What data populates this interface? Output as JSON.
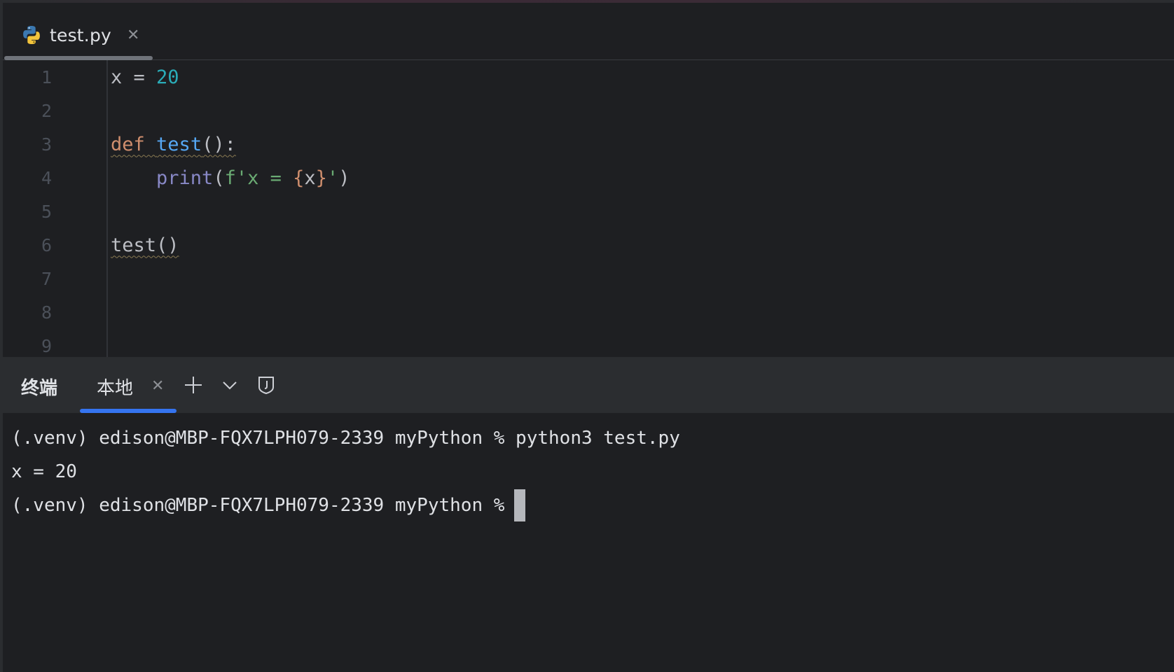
{
  "tabs": [
    {
      "label": "test.py",
      "icon": "python-file-icon",
      "active": true
    }
  ],
  "editor": {
    "line_numbers": [
      "1",
      "2",
      "3",
      "4",
      "5",
      "6",
      "7",
      "8",
      "9"
    ],
    "lines": {
      "l1_var": "x",
      "l1_op": " = ",
      "l1_num": "20",
      "l3_kw": "def",
      "l3_fn": "test",
      "l3_rest": "():",
      "l4_indent": "    ",
      "l4_print": "print",
      "l4_paren_open": "(",
      "l4_str_start": "f'x = ",
      "l4_brace_open": "{",
      "l4_x": "x",
      "l4_brace_close": "}",
      "l4_str_end": "'",
      "l4_paren_close": ")",
      "l6_call": "test()"
    }
  },
  "terminal": {
    "title": "终端",
    "tab_label": "本地",
    "lines": [
      "(.venv) edison@MBP-FQX7LPH079-2339 myPython % python3 test.py",
      "x = 20",
      "(.venv) edison@MBP-FQX7LPH079-2339 myPython %"
    ]
  },
  "colors": {
    "background": "#1e1f22",
    "keyword": "#cf8e6d",
    "function": "#56a8f5",
    "number": "#2aacb8",
    "builtin": "#8888c6",
    "string": "#6aab73",
    "accent": "#3574f0"
  }
}
